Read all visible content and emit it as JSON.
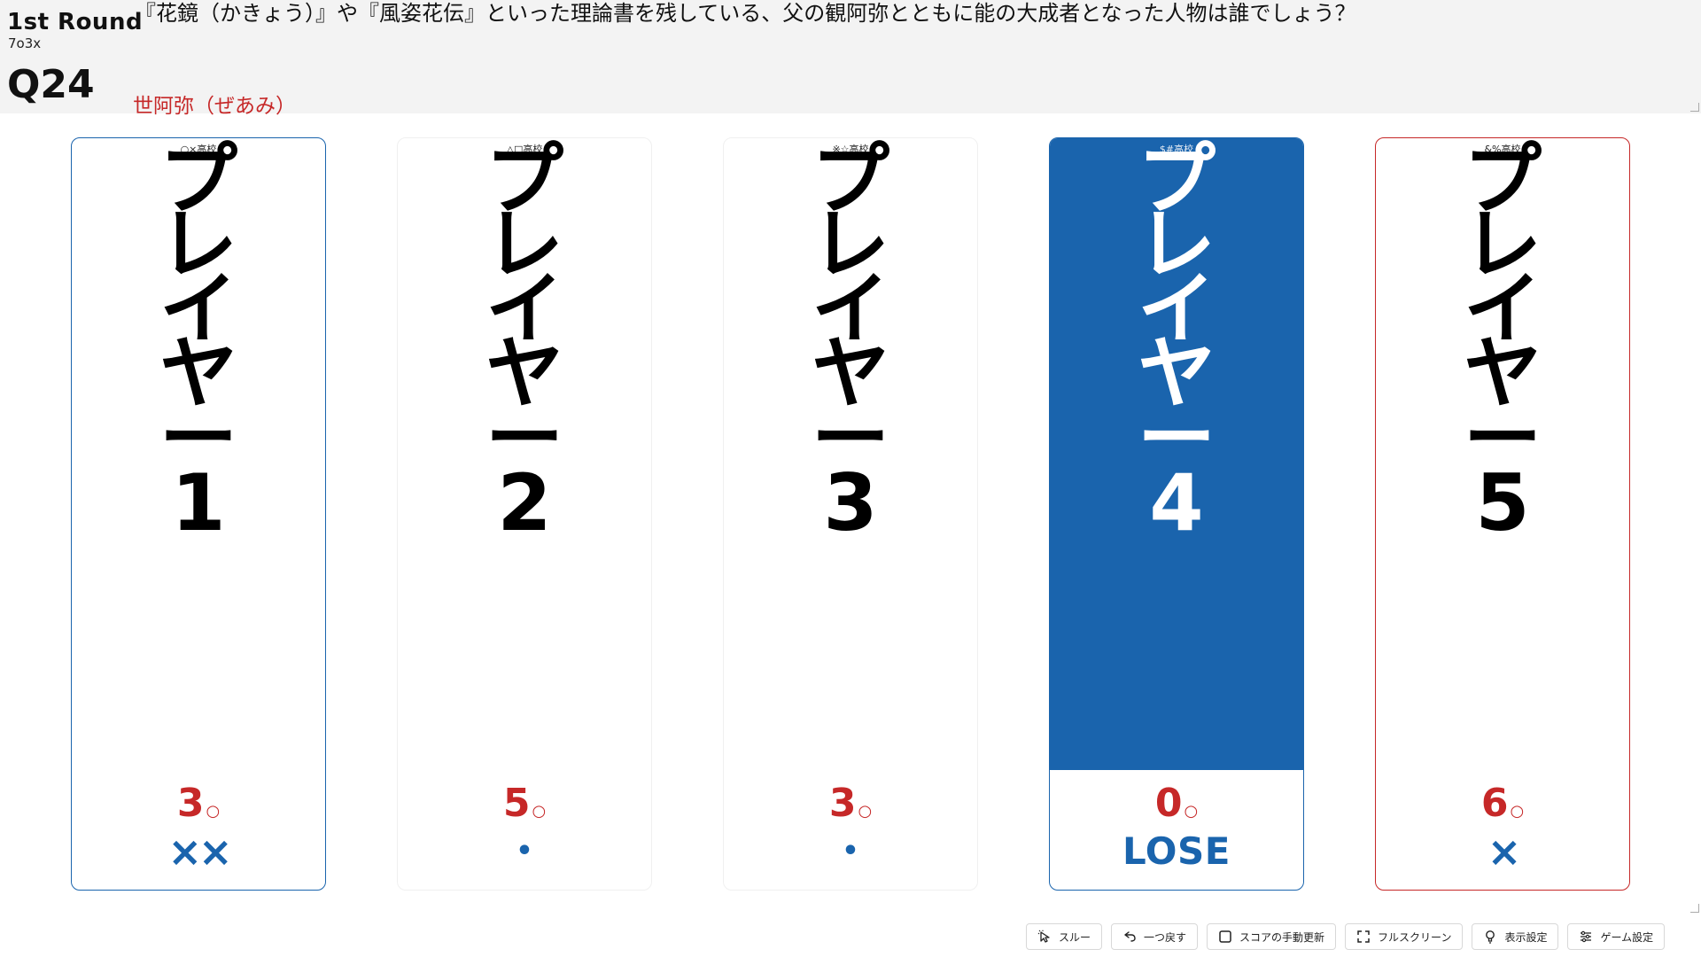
{
  "header": {
    "round_title": "1st Round",
    "rule": "7o3x",
    "question_number": "Q24",
    "question": "『花鏡（かきょう）』や『風姿花伝』といった理論書を残している、父の観阿弥とともに能の大成者となった人物は誰でしょう？",
    "answer": "世阿弥（ぜあみ）"
  },
  "players": [
    {
      "belong": "○×高校",
      "name": [
        "プ",
        "レ",
        "イ",
        "ヤ",
        "ー",
        "1"
      ],
      "score": "3",
      "score_unit": "○",
      "status": "××",
      "status_type": "xs"
    },
    {
      "belong": "△□高校",
      "name": [
        "プ",
        "レ",
        "イ",
        "ヤ",
        "ー",
        "2"
      ],
      "score": "5",
      "score_unit": "○",
      "status": "•",
      "status_type": "dot"
    },
    {
      "belong": "※☆高校",
      "name": [
        "プ",
        "レ",
        "イ",
        "ヤ",
        "ー",
        "3"
      ],
      "score": "3",
      "score_unit": "○",
      "status": "•",
      "status_type": "dot"
    },
    {
      "belong": "$#高校",
      "name": [
        "プ",
        "レ",
        "イ",
        "ヤ",
        "ー",
        "4"
      ],
      "score": "0",
      "score_unit": "○",
      "status": "LOSE",
      "status_type": "lose"
    },
    {
      "belong": "&%高校",
      "name": [
        "プ",
        "レ",
        "イ",
        "ヤ",
        "ー",
        "5"
      ],
      "score": "6",
      "score_unit": "○",
      "status": "×",
      "status_type": "xs"
    }
  ],
  "toolbar": {
    "through": "スルー",
    "undo": "一つ戻す",
    "manual_update": "スコアの手動更新",
    "fullscreen": "フルスクリーン",
    "display_settings": "表示設定",
    "game_settings": "ゲーム設定"
  },
  "colors": {
    "accent_blue": "#1a64ad",
    "accent_red": "#c62828",
    "header_bg": "#f3f3f3"
  }
}
